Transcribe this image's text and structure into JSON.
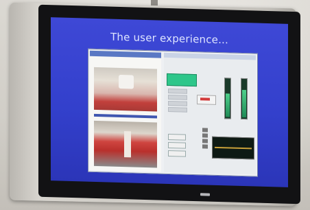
{
  "slide": {
    "title": "The user experience..."
  },
  "colors": {
    "slide_background": "#3340cc",
    "button_green": "#2ec68a",
    "tv_frame": "#121214"
  }
}
